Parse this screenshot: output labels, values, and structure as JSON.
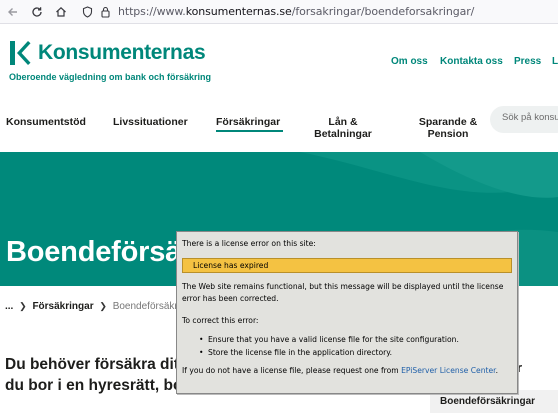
{
  "browser": {
    "url_prefix": "https://www.",
    "url_host": "konsumenternas.se",
    "url_path": "/forsakringar/boendeforsakringar/"
  },
  "site": {
    "logo_text": "Konsumenternas",
    "tagline": "Oberoende vägledning om bank och försäkring",
    "top_links": [
      "Om oss",
      "Kontakta oss",
      "Press",
      "L"
    ],
    "brand_color": "#00877a"
  },
  "menu": {
    "items": [
      "Konsumentstöd",
      "Livssituationer",
      "Försäkringar",
      "Lån &\nBetalningar",
      "Sparande &\nPension"
    ],
    "active_index": 2,
    "search_placeholder": "Sök på konsume"
  },
  "hero": {
    "title": "Boendeförsäk"
  },
  "breadcrumb": {
    "home": "...",
    "items": [
      "Försäkringar"
    ],
    "current": "Boendeförsäkrin"
  },
  "content": {
    "intro_line1": "Du behöver försäkra ditt",
    "intro_line2": "du bor i en hyresrätt, bos",
    "side_fragment": "r",
    "side_box_label": "Boendeförsäkringar"
  },
  "license_notice": {
    "heading": "There is a license error on this site:",
    "badge": "License has expired",
    "message": "The Web site remains functional, but this message will be displayed until the license error has been corrected.",
    "to_correct": "To correct this error:",
    "steps": [
      "Ensure that you have a valid license file for the site configuration.",
      "Store the license file in the application directory."
    ],
    "footer_prefix": "If you do not have a license file, please request one from ",
    "footer_link": "EPiServer License Center",
    "footer_suffix": "."
  }
}
